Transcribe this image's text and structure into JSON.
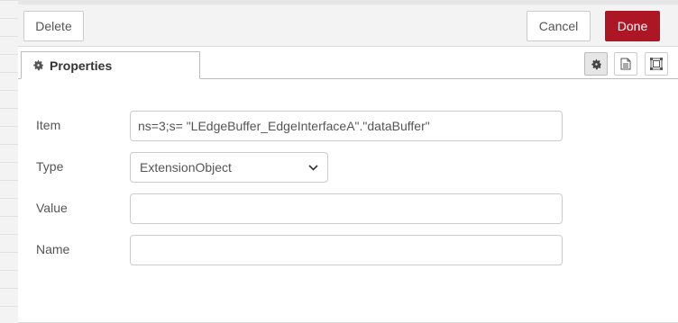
{
  "toolbar": {
    "delete_label": "Delete",
    "cancel_label": "Cancel",
    "done_label": "Done"
  },
  "tabs": [
    {
      "label": "Properties",
      "icon": "gear-icon",
      "active": true
    }
  ],
  "tab_buttons": [
    {
      "icon": "gear-icon",
      "active": true
    },
    {
      "icon": "document-icon",
      "active": false
    },
    {
      "icon": "frame-icon",
      "active": false
    }
  ],
  "form": {
    "item": {
      "label": "Item",
      "value": "ns=3;s= \"LEdgeBuffer_EdgeInterfaceA\".\"dataBuffer\""
    },
    "type": {
      "label": "Type",
      "value": "ExtensionObject"
    },
    "value": {
      "label": "Value",
      "value": ""
    },
    "name": {
      "label": "Name",
      "value": ""
    }
  },
  "colors": {
    "primary": "#ad1625",
    "border": "#cccccc",
    "toolbar_bg": "#f3f3f3"
  }
}
